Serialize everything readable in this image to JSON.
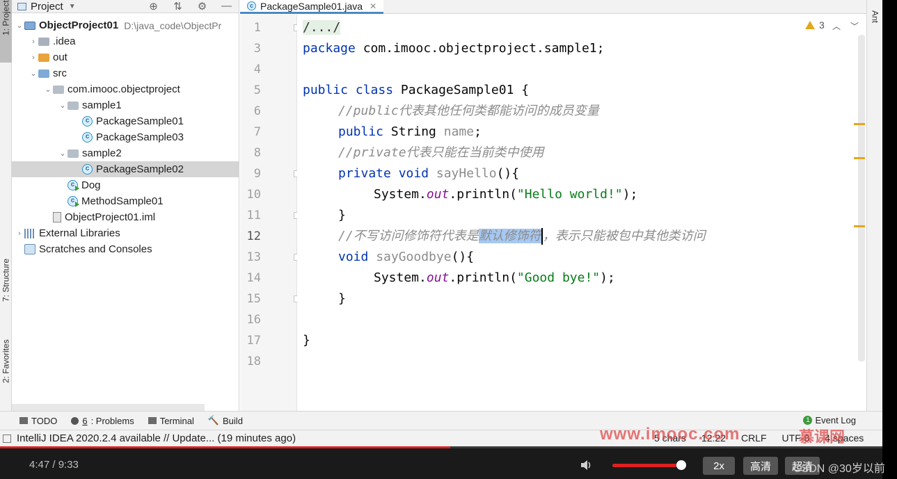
{
  "left_stripe": {
    "project_tab": "1: Project",
    "structure_tab": "7: Structure",
    "favorites_tab": "2: Favorites"
  },
  "project_panel": {
    "title": "Project",
    "tree": [
      {
        "name": "ObjectProject01",
        "path": "D:\\java_code\\ObjectPr",
        "icon": "module-icon",
        "arrow": "expanded",
        "indent": 0
      },
      {
        "name": ".idea",
        "icon": "folder-icon",
        "arrow": "collapsed",
        "indent": 1
      },
      {
        "name": "out",
        "icon": "folder-orange-icon",
        "arrow": "collapsed",
        "indent": 1
      },
      {
        "name": "src",
        "icon": "source-folder-icon",
        "arrow": "expanded",
        "indent": 1
      },
      {
        "name": "com.imooc.objectproject",
        "icon": "package-icon",
        "arrow": "expanded",
        "indent": 2
      },
      {
        "name": "sample1",
        "icon": "package-icon",
        "arrow": "expanded",
        "indent": 3
      },
      {
        "name": "PackageSample01",
        "icon": "class-icon",
        "arrow": "none",
        "indent": 4
      },
      {
        "name": "PackageSample03",
        "icon": "class-icon",
        "arrow": "none",
        "indent": 4
      },
      {
        "name": "sample2",
        "icon": "package-icon",
        "arrow": "expanded",
        "indent": 3
      },
      {
        "name": "PackageSample02",
        "icon": "class-icon",
        "arrow": "none",
        "indent": 4,
        "selected": true
      },
      {
        "name": "Dog",
        "icon": "runnable-class-icon",
        "arrow": "none",
        "indent": 3
      },
      {
        "name": "MethodSample01",
        "icon": "runnable-class-icon",
        "arrow": "none",
        "indent": 3
      },
      {
        "name": "ObjectProject01.iml",
        "icon": "iml-file-icon",
        "arrow": "none",
        "indent": 2
      },
      {
        "name": "External Libraries",
        "icon": "libraries-icon",
        "arrow": "collapsed",
        "indent": 0
      },
      {
        "name": "Scratches and Consoles",
        "icon": "scratches-icon",
        "arrow": "none",
        "indent": 0
      }
    ]
  },
  "editor": {
    "tab_label": "PackageSample01.java",
    "warning_count": "3",
    "line_numbers": [
      "1",
      "3",
      "4",
      "5",
      "6",
      "7",
      "8",
      "9",
      "10",
      "11",
      "12",
      "13",
      "14",
      "15",
      "16",
      "17",
      "18"
    ],
    "current_line": "12",
    "code": {
      "l1": "/.../",
      "l3_kw": "package",
      "l3_rest": " com.imooc.objectproject.sample1;",
      "l5_kw": "public class",
      "l5_rest": " PackageSample01 {",
      "l6": "//public代表其他任何类都能访问的成员变量",
      "l7_kw": "public",
      "l7_type": " String ",
      "l7_field": "name",
      "l7_end": ";",
      "l8": "//private代表只能在当前类中使用",
      "l9_kw": "private void",
      "l9_method": " sayHello",
      "l9_end": "(){",
      "l10_a": "System.",
      "l10_out": "out",
      "l10_b": ".println(",
      "l10_str": "\"Hello world!\"",
      "l10_c": ");",
      "l11": "}",
      "l12_a": "//不写访问修饰符代表是",
      "l12_sel": "默认修饰符",
      "l12_b": "，表示只能被包中其他类访问",
      "l13_kw": "void",
      "l13_method": " sayGoodbye",
      "l13_end": "(){",
      "l14_a": "System.",
      "l14_out": "out",
      "l14_b": ".println(",
      "l14_str": "\"Good bye!\"",
      "l14_c": ");",
      "l15": "}",
      "l17": "}"
    }
  },
  "right_stripe": {
    "ant_tab": "Ant"
  },
  "bottom_tabs": {
    "todo": "TODO",
    "problems_num": "6",
    "problems": ": Problems",
    "terminal": "Terminal",
    "build": "Build",
    "event_log_count": "1",
    "event_log": "Event Log"
  },
  "status_bar": {
    "message": "IntelliJ IDEA 2020.2.4 available // Update... (19 minutes ago)",
    "chars": "5 chars",
    "position": "12:22",
    "line_sep": "CRLF",
    "encoding": "UTF-8",
    "indent": "4 spaces"
  },
  "watermark": {
    "site": "www.imooc.com",
    "cn": "慕课网"
  },
  "player": {
    "time": "4:47 / 9:33",
    "progress": 0.51,
    "volume": 0.92,
    "speed": "2x",
    "quality": "高清",
    "quality2": "超清",
    "csdn": "CSDN @30岁以前"
  }
}
